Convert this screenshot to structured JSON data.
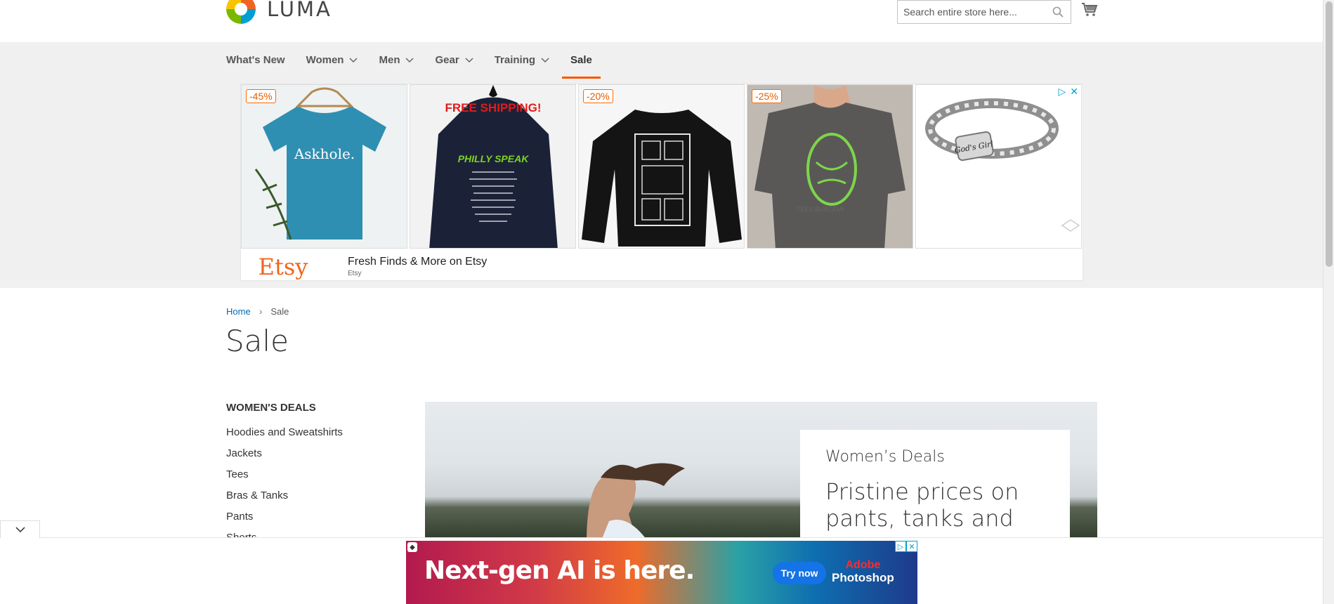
{
  "brand": {
    "name": "LUMA"
  },
  "search": {
    "placeholder": "Search entire store here..."
  },
  "nav": {
    "items": [
      {
        "label": "What's New",
        "has_dropdown": false
      },
      {
        "label": "Women",
        "has_dropdown": true
      },
      {
        "label": "Men",
        "has_dropdown": true
      },
      {
        "label": "Gear",
        "has_dropdown": true
      },
      {
        "label": "Training",
        "has_dropdown": true
      },
      {
        "label": "Sale",
        "has_dropdown": false,
        "active": true
      }
    ]
  },
  "top_ad": {
    "tiles": [
      {
        "badge": "-45%",
        "image": "blue-tee-askhole",
        "text": "Askhole."
      },
      {
        "badge": "",
        "image": "navy-hoodie-philly-speak",
        "overlay": "FREE SHIPPING!",
        "text": "PHILLY SPEAK"
      },
      {
        "badge": "-20%",
        "image": "black-sweatshirt-print"
      },
      {
        "badge": "-25%",
        "image": "grey-oversized-tee"
      },
      {
        "badge": "",
        "image": "gods-girl-bracelet"
      }
    ],
    "logo": "Etsy",
    "title": "Fresh Finds & More on Etsy",
    "subtitle": "Etsy",
    "accent": "#f1641e"
  },
  "breadcrumb": {
    "home": "Home",
    "separator": "›",
    "current": "Sale"
  },
  "page": {
    "title": "Sale"
  },
  "sidebar": {
    "title": "WOMEN'S DEALS",
    "links": [
      "Hoodies and Sweatshirts",
      "Jackets",
      "Tees",
      "Bras & Tanks",
      "Pants",
      "Shorts"
    ]
  },
  "hero": {
    "kicker": "Women’s Deals",
    "headline": "Pristine prices on pants, tanks and"
  },
  "bottom_ad": {
    "headline": "Next-gen AI is here.",
    "cta": "Try now",
    "brand_line1": "Adobe",
    "brand_line2": "Photoshop"
  },
  "colors": {
    "accent": "#ff5501",
    "link": "#006bb4",
    "nav_bg": "#f0f0f0"
  }
}
